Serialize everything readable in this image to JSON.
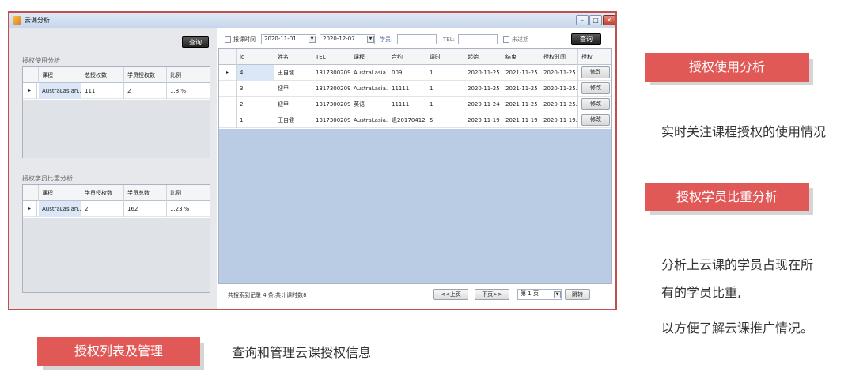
{
  "window": {
    "title": "云课分析",
    "btn_min": "–",
    "btn_max": "□",
    "btn_close": "✕"
  },
  "left_panel": {
    "query_button": "查询",
    "usage_section": {
      "title": "授权使用分析",
      "columns": [
        "课程",
        "总授权数",
        "学员授权数",
        "比例"
      ],
      "rows": [
        {
          "marker": "▸",
          "cells": [
            "AustraLasian...",
            "111",
            "2",
            "1.8 %"
          ]
        }
      ]
    },
    "ratio_section": {
      "title": "授权学员比重分析",
      "columns": [
        "课程",
        "学员授权数",
        "学员总数",
        "比例"
      ],
      "rows": [
        {
          "marker": "▸",
          "cells": [
            "AustraLasian...",
            "2",
            "162",
            "1.23 %"
          ]
        }
      ]
    }
  },
  "filter": {
    "date_checkbox_label": "报课时间",
    "date_from": "2020-11-01",
    "date_to": "2020-12-07",
    "student_label": "学员:",
    "student_value": "",
    "tel_label": "TEL:",
    "tel_value": "",
    "expired_label": "未过期",
    "query_button": "查询"
  },
  "main_table": {
    "columns": [
      "id",
      "姓名",
      "TEL",
      "课程",
      "合约",
      "课时",
      "起始",
      "结束",
      "授权时间",
      "授权"
    ],
    "rows": [
      {
        "marker": "▸",
        "cells": [
          "4",
          "王自健",
          "13173002095",
          "AustraLasia...",
          "009",
          "1",
          "2020-11-25",
          "2021-11-25",
          "2020-11-25..."
        ],
        "action": "修改"
      },
      {
        "marker": "",
        "cells": [
          "3",
          "钮甲",
          "13173002095",
          "AustraLasia...",
          "11111",
          "1",
          "2020-11-25",
          "2021-11-25",
          "2020-11-25..."
        ],
        "action": "修改"
      },
      {
        "marker": "",
        "cells": [
          "2",
          "钮甲",
          "13173002095",
          "英语",
          "11111",
          "1",
          "2020-11-24",
          "2021-11-25",
          "2020-11-25..."
        ],
        "action": "修改"
      },
      {
        "marker": "",
        "cells": [
          "1",
          "王自健",
          "13173002095",
          "AustraLasia...",
          "退20170412",
          "5",
          "2020-11-19",
          "2021-11-19",
          "2020-11-19..."
        ],
        "action": "修改"
      }
    ]
  },
  "pager": {
    "summary": "共搜索到记录 4 条,共计课时数8",
    "prev": "<<上页",
    "next": "下页>>",
    "page": "第 1 页",
    "jump": "跳转"
  },
  "annotations": {
    "usage_tag": "授权使用分析",
    "usage_desc": "实时关注课程授权的使用情况",
    "ratio_tag": "授权学员比重分析",
    "ratio_desc_1": "分析上云课的学员占现在所",
    "ratio_desc_2": "有的学员比重,",
    "ratio_desc_3": "以方便了解云课推广情况。",
    "list_tag": "授权列表及管理",
    "list_desc": "查询和管理云课授权信息"
  },
  "colors": {
    "tag_red": "#e15957",
    "frame_red": "#c0504d",
    "grid_blue": "#b9cce4"
  }
}
